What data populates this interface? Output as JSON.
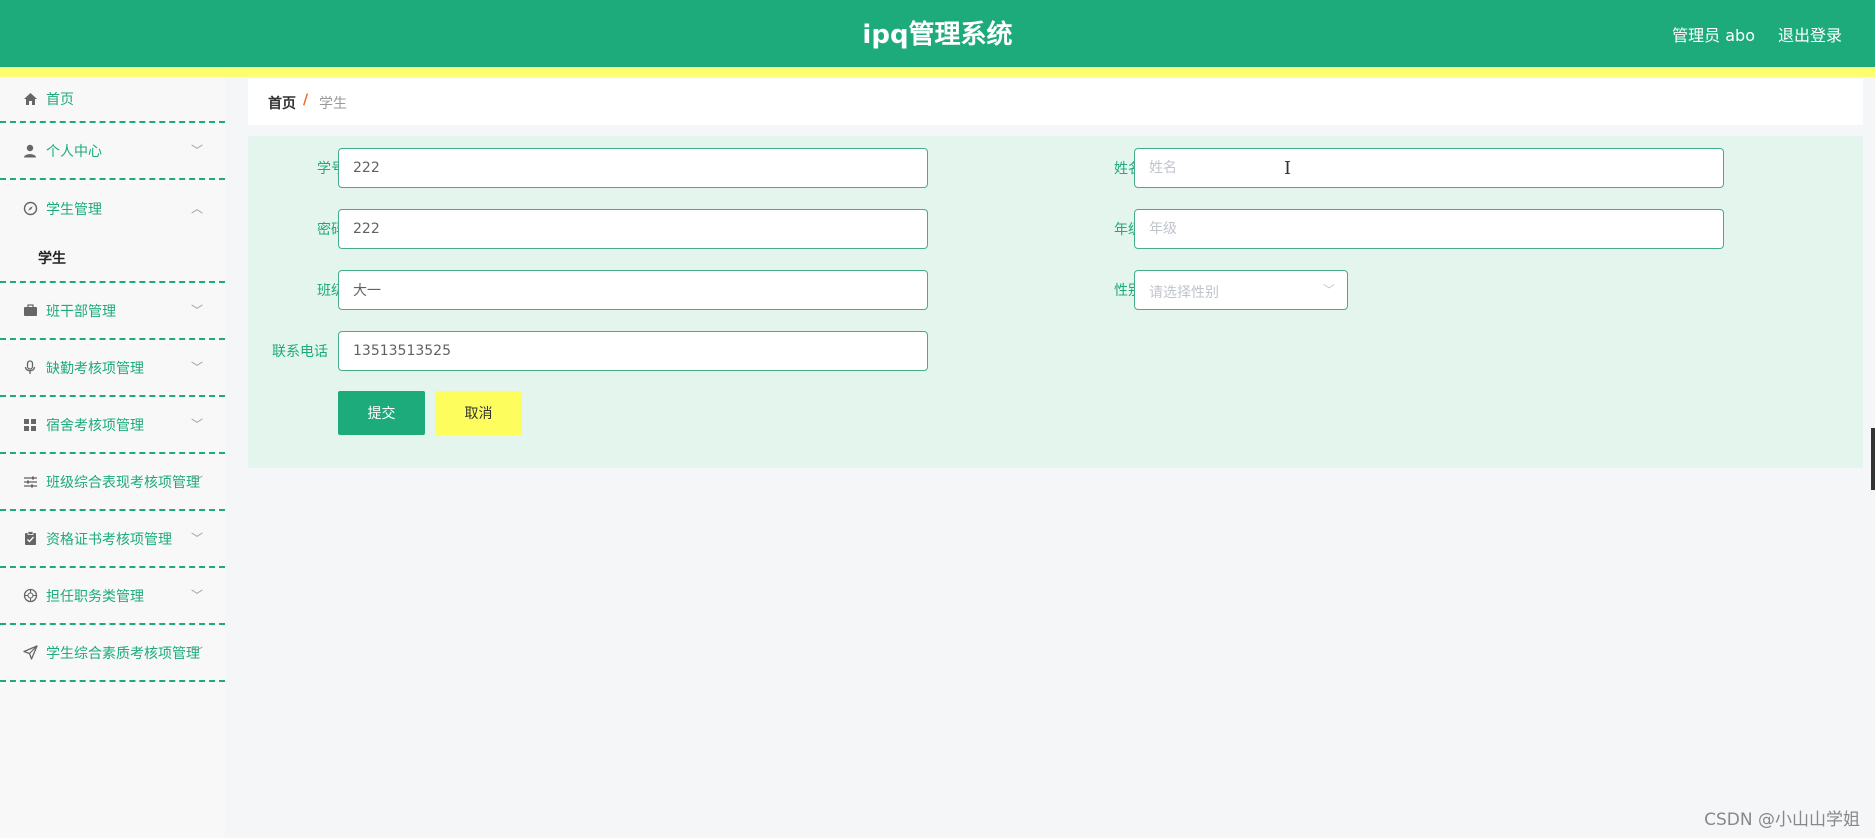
{
  "header": {
    "title": "ipq管理系统",
    "user": "管理员 abo",
    "logout": "退出登录"
  },
  "sidebar": {
    "items": [
      {
        "label": "首页",
        "icon": "home-icon"
      },
      {
        "label": "个人中心",
        "icon": "user-icon"
      },
      {
        "label": "学生管理",
        "icon": "compass-icon",
        "expanded": true,
        "sub": [
          "学生"
        ]
      },
      {
        "label": "班干部管理",
        "icon": "briefcase-icon"
      },
      {
        "label": "缺勤考核项管理",
        "icon": "microphone-icon"
      },
      {
        "label": "宿舍考核项管理",
        "icon": "grid-icon"
      },
      {
        "label": "班级综合表现考核项管理",
        "icon": "sliders-icon"
      },
      {
        "label": "资格证书考核项管理",
        "icon": "clipboard-icon"
      },
      {
        "label": "担任职务类管理",
        "icon": "target-icon"
      },
      {
        "label": "学生综合素质考核项管理",
        "icon": "send-icon"
      }
    ]
  },
  "breadcrumb": {
    "home": "首页",
    "separator": "/",
    "current": "学生"
  },
  "form": {
    "student_id": {
      "label": "学号",
      "value": "222"
    },
    "name": {
      "label": "姓名",
      "placeholder": "姓名"
    },
    "password": {
      "label": "密码",
      "value": "222"
    },
    "grade": {
      "label": "年级",
      "placeholder": "年级"
    },
    "class": {
      "label": "班级",
      "value": "大一"
    },
    "gender": {
      "label": "性别",
      "placeholder": "请选择性别"
    },
    "phone": {
      "label": "联系电话",
      "value": "13513513525"
    },
    "submit": "提交",
    "cancel": "取消"
  },
  "watermark": "CSDN @小山山学姐",
  "colors": {
    "primary": "#1dab7b",
    "accent_yellow": "#fdfd70",
    "form_bg": "#e4f5ee"
  }
}
